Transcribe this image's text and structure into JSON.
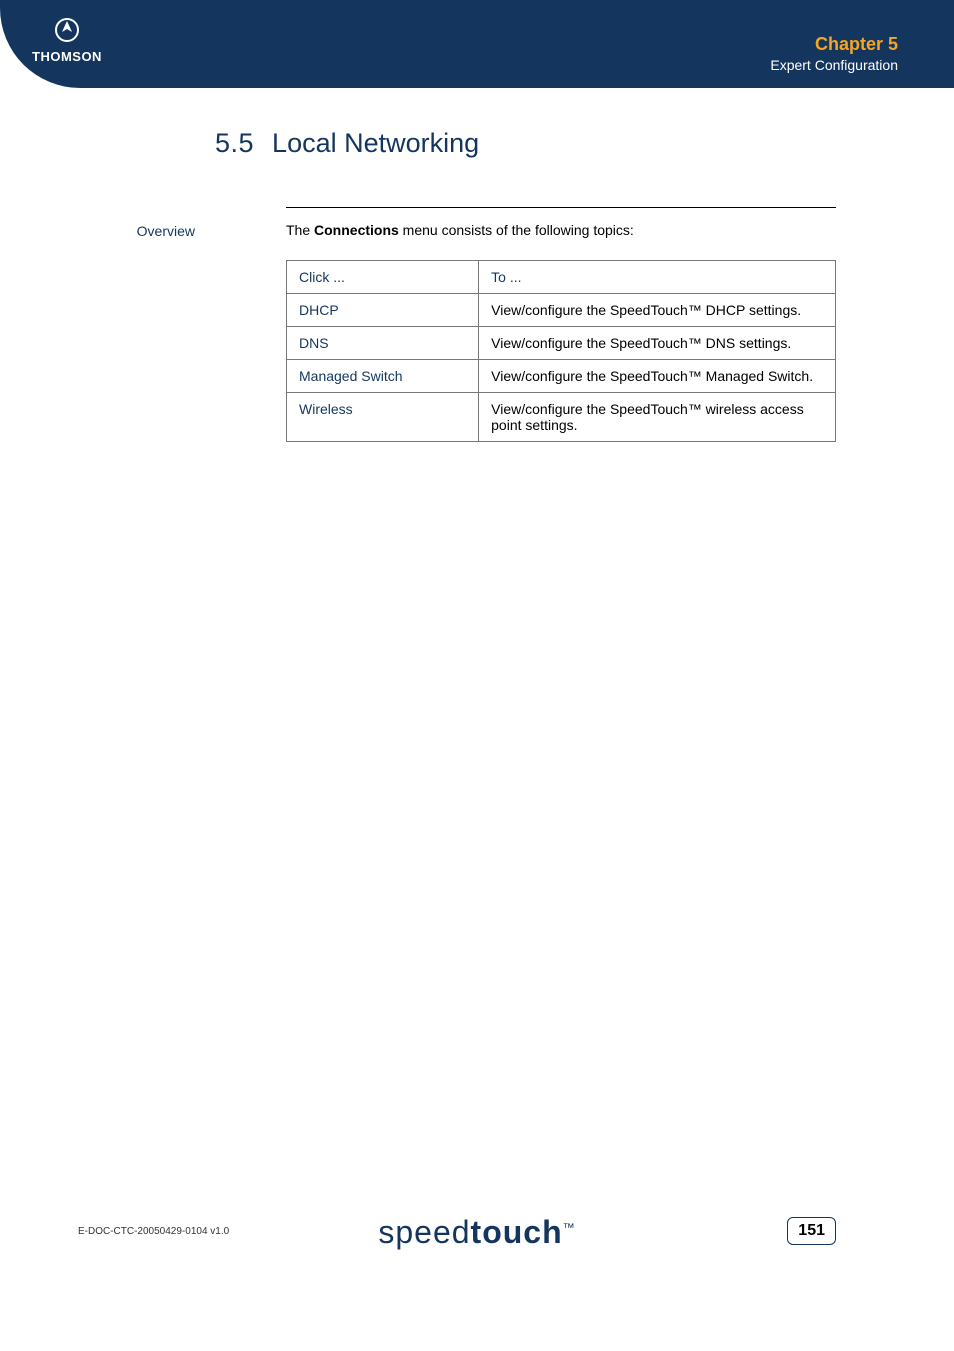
{
  "header": {
    "chapter": "Chapter 5",
    "subtitle": "Expert Configuration",
    "logo_text": "THOMSON"
  },
  "section": {
    "number": "5.5",
    "title": "Local Networking"
  },
  "sidelabel": "Overview",
  "intro_prefix": "The ",
  "intro_bold": "Connections",
  "intro_suffix": " menu consists of the following topics:",
  "table": {
    "header": {
      "click": "Click ...",
      "to": "To ..."
    },
    "rows": [
      {
        "click": "DHCP",
        "to": "View/configure the SpeedTouch™ DHCP settings."
      },
      {
        "click": "DNS",
        "to": "View/configure the SpeedTouch™ DNS settings."
      },
      {
        "click": "Managed Switch",
        "to": "View/configure the SpeedTouch™ Managed Switch."
      },
      {
        "click": "Wireless",
        "to": "View/configure the SpeedTouch™ wireless access point settings."
      }
    ]
  },
  "footer": {
    "docid": "E-DOC-CTC-20050429-0104 v1.0",
    "brand_light": "speed",
    "brand_bold": "touch",
    "brand_tm": "™",
    "page": "151"
  }
}
